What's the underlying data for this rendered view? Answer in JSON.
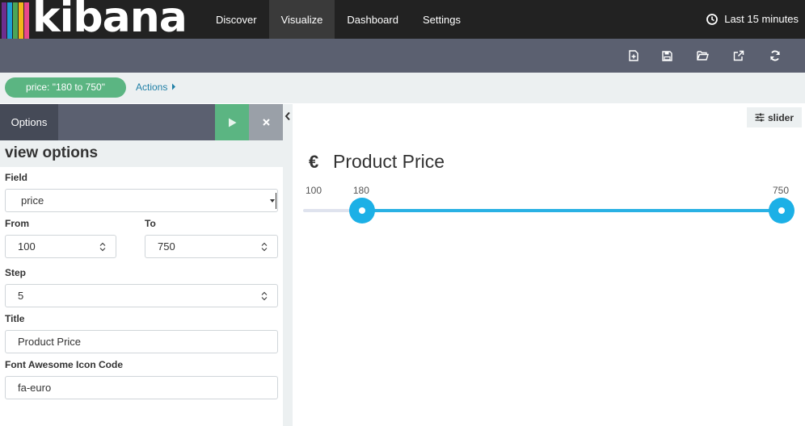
{
  "brand": {
    "name": "kibana",
    "stripe_colors": [
      "#e8488b",
      "#3ebeb0",
      "#f2b51b",
      "#1f9fd6",
      "#4ca657",
      "#e8488b"
    ]
  },
  "nav": {
    "items": [
      "Discover",
      "Visualize",
      "Dashboard",
      "Settings"
    ],
    "active": "Visualize"
  },
  "timepicker": {
    "label": "Last 15 minutes"
  },
  "toolbar": {
    "icons": [
      "new-visualization-icon",
      "save-icon",
      "open-icon",
      "share-icon",
      "refresh-icon"
    ]
  },
  "filter": {
    "pill": "price: \"180 to 750\"",
    "actions": "Actions"
  },
  "sidebar": {
    "tab": "Options",
    "heading": "view options",
    "field": {
      "label": "Field",
      "value": "price"
    },
    "from": {
      "label": "From",
      "value": "100"
    },
    "to": {
      "label": "To",
      "value": "750"
    },
    "step": {
      "label": "Step",
      "value": "5"
    },
    "title": {
      "label": "Title",
      "value": "Product Price"
    },
    "icon_code": {
      "label": "Font Awesome Icon Code",
      "value": "fa-euro"
    }
  },
  "visualization": {
    "type_tag": "slider",
    "title": "Product Price",
    "icon": "€",
    "range": {
      "min": 100,
      "max": 750
    },
    "selection": {
      "low": 180,
      "high": 750
    },
    "labels": {
      "min": "100",
      "low": "180",
      "high": "750"
    },
    "colors": {
      "track": "#dfe3ee",
      "fill": "#29b1e4",
      "handle": "#1cb0e6"
    }
  }
}
